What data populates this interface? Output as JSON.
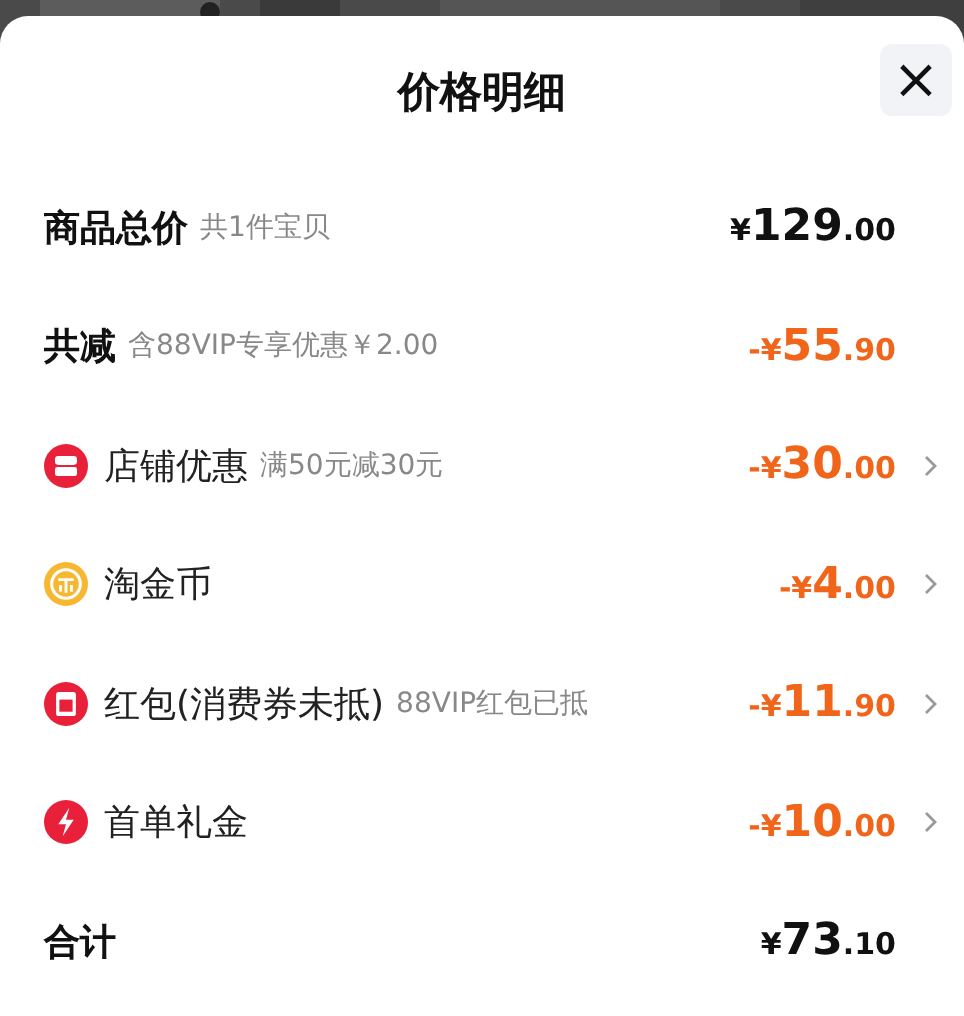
{
  "header": {
    "title": "价格明细",
    "close": "×"
  },
  "rows": [
    {
      "kind": "subtotal",
      "label": "商品总价",
      "note": "共1件宝贝",
      "price": {
        "currency": "¥",
        "integer": "129",
        "fraction": ".00"
      },
      "discount": false,
      "chevron": false
    },
    {
      "kind": "reduction",
      "label": "共减",
      "note": "含88VIP专享优惠￥2.00",
      "price": {
        "currency": "-¥",
        "integer": "55",
        "fraction": ".90"
      },
      "discount": true,
      "chevron": false
    },
    {
      "kind": "store",
      "label": "店铺优惠",
      "note": "满50元减30元",
      "price": {
        "currency": "-¥",
        "integer": "30",
        "fraction": ".00"
      },
      "discount": true,
      "chevron": true
    },
    {
      "kind": "coin",
      "label": "淘金币",
      "price": {
        "currency": "-¥",
        "integer": "4",
        "fraction": ".00"
      },
      "discount": true,
      "chevron": true
    },
    {
      "kind": "envelope",
      "label": "红包(消费券未抵)",
      "note": "88VIP红包已抵",
      "price": {
        "currency": "-¥",
        "integer": "11",
        "fraction": ".90"
      },
      "discount": true,
      "chevron": true
    },
    {
      "kind": "bolt",
      "label": "首单礼金",
      "price": {
        "currency": "-¥",
        "integer": "10",
        "fraction": ".00"
      },
      "discount": true,
      "chevron": true
    },
    {
      "kind": "total",
      "label": "合计",
      "price": {
        "currency": "¥",
        "integer": "73",
        "fraction": ".10"
      },
      "discount": false,
      "chevron": false
    }
  ]
}
